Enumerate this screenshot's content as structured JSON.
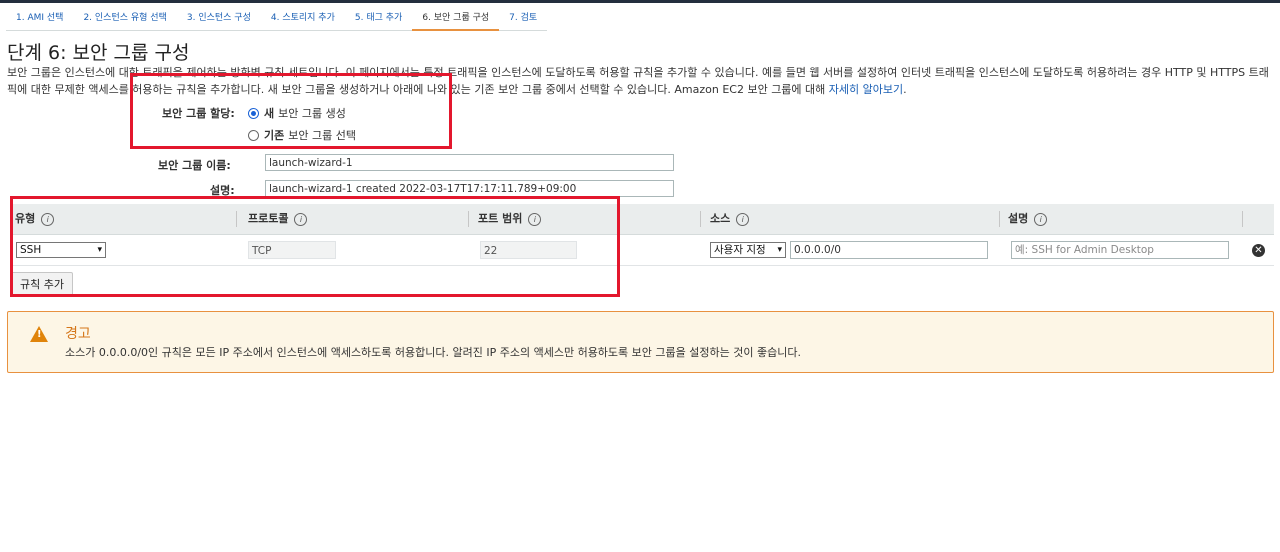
{
  "wizard": {
    "steps": [
      {
        "label": "1. AMI 선택"
      },
      {
        "label": "2. 인스턴스 유형 선택"
      },
      {
        "label": "3. 인스턴스 구성"
      },
      {
        "label": "4. 스토리지 추가"
      },
      {
        "label": "5. 태그 추가"
      },
      {
        "label": "6. 보안 그룹 구성"
      },
      {
        "label": "7. 검토"
      }
    ],
    "active_index": 5
  },
  "page": {
    "title": "단계 6: 보안 그룹 구성",
    "description": "보안 그룹은 인스턴스에 대한 트래픽을 제어하는 방화벽 규칙 세트입니다. 이 페이지에서는 특정 트래픽을 인스턴스에 도달하도록 허용할 규칙을 추가할 수 있습니다. 예를 들면 웹 서버를 설정하여 인터넷 트래픽을 인스턴스에 도달하도록 허용하려는 경우 HTTP 및 HTTPS 트래픽에 대한 무제한 액세스를 허용하는 규칙을 추가합니다. 새 보안 그룹을 생성하거나 아래에 나와 있는 기존 보안 그룹 중에서 선택할 수 있습니다. Amazon EC2 보안 그룹에 대해",
    "learn_more": "자세히 알아보기",
    "learn_more_suffix": "."
  },
  "assign": {
    "label": "보안 그룹 할당:",
    "option_new_bold": "새",
    "option_new": "보안 그룹 생성",
    "option_existing_bold": "기존",
    "option_existing": "보안 그룹 선택",
    "selected": "new"
  },
  "form": {
    "name_label": "보안 그룹 이름:",
    "name_value": "launch-wizard-1",
    "desc_label": "설명:",
    "desc_value": "launch-wizard-1 created 2022-03-17T17:17:11.789+09:00"
  },
  "table": {
    "headers": {
      "type": "유형",
      "protocol": "프로토콜",
      "port_range": "포트 범위",
      "source": "소스",
      "description": "설명"
    },
    "info_glyph": "i",
    "rows": [
      {
        "type": "SSH",
        "protocol": "TCP",
        "port_range": "22",
        "source_select": "사용자 지정",
        "source_value": "0.0.0.0/0",
        "description_placeholder": "예: SSH for Admin Desktop"
      }
    ],
    "remove_glyph": "✕",
    "caret_glyph": "▾"
  },
  "add_rule_label": "규칙 추가",
  "warning": {
    "icon_glyph": "!",
    "title": "경고",
    "text": "소스가 0.0.0.0/0인 규칙은 모든 IP 주소에서 인스턴스에 액세스하도록 허용합니다. 알려진 IP 주소의 액세스만 허용하도록 보안 그룹을 설정하는 것이 좋습니다."
  },
  "colors": {
    "link": "#1a5fb4",
    "active_tab_underline": "#e8913f",
    "annotation_box": "#e3172d",
    "warning_border": "#e8913f",
    "warning_bg": "#fdf6e6"
  }
}
